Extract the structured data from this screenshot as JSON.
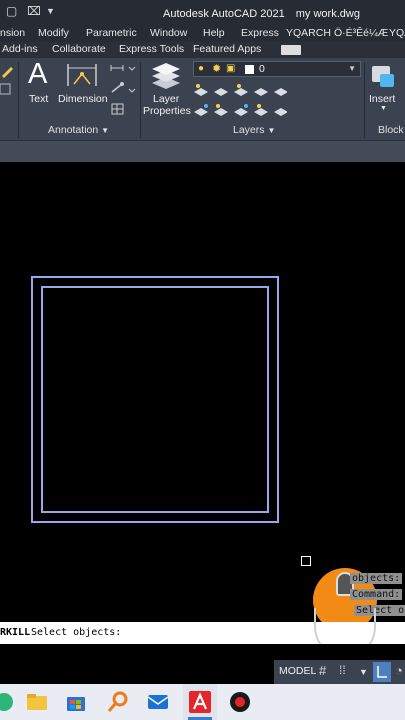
{
  "app": {
    "title": "Autodesk AutoCAD 2021",
    "document": "my work.dwg"
  },
  "menu": [
    "nsion",
    "Modify",
    "Parametric",
    "Window",
    "Help",
    "Express",
    "YQARCH",
    "Ö·É³Êé¼Æ",
    "YQA"
  ],
  "tabs": [
    "Add-ins",
    "Collaborate",
    "Express Tools",
    "Featured Apps"
  ],
  "ribbon": {
    "text_label": "Text",
    "dimension_label": "Dimension",
    "annotation_panel": "Annotation",
    "layer_properties_line1": "Layer",
    "layer_properties_line2": "Properties",
    "layers_panel": "Layers",
    "current_layer": "0",
    "insert_label": "Insert",
    "block_panel": "Block"
  },
  "command_history": [
    "objects:",
    "Command:",
    "Select ob"
  ],
  "command_line": {
    "command": "RKILL",
    "prompt": "Select objects:"
  },
  "status": {
    "model_label": "MODEL"
  },
  "colors": {
    "drawing_lines": "#97a8ee",
    "ribbon_bg": "#3b4250",
    "titlebar_bg": "#272b34",
    "canvas_bg": "#000000"
  }
}
